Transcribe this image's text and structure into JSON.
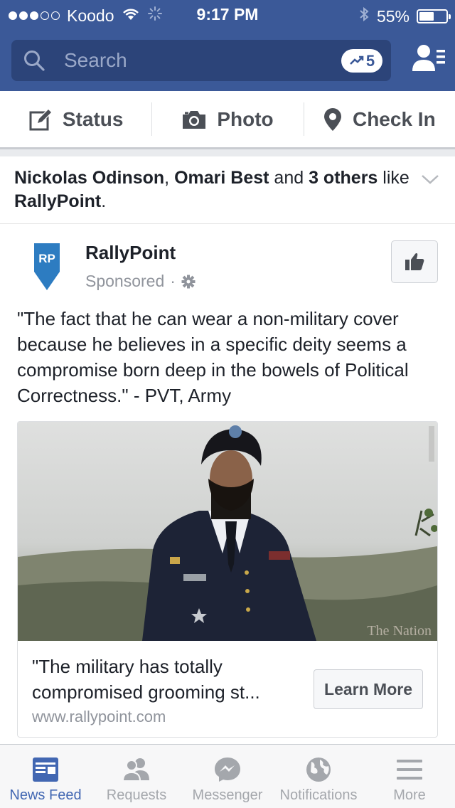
{
  "status_bar": {
    "carrier": "Koodo",
    "time": "9:17 PM",
    "battery_text": "55%",
    "battery_level": 0.55,
    "signal_bars_filled": 3,
    "signal_bars_total": 5
  },
  "search": {
    "placeholder": "Search",
    "trending_count": "5"
  },
  "composer": {
    "status_label": "Status",
    "photo_label": "Photo",
    "checkin_label": "Check In"
  },
  "story": {
    "social_name1": "Nickolas Odinson",
    "social_sep": ", ",
    "social_name2": "Omari Best",
    "social_and": " and ",
    "social_others": "3 others",
    "social_like": " like ",
    "social_page": "RallyPoint",
    "social_end": ".",
    "logo_text": "RP",
    "page_name": "RallyPoint",
    "sponsored": "Sponsored",
    "sponsored_dot": "·",
    "text": "\"The fact that he can wear a non-military cover because he believes in a specific deity seems a compromise born deep in the bowels of Political Correctness.\" - PVT, Army",
    "photo_watermark": "The Nation",
    "link_title": "\"The military has totally compromised grooming st...",
    "link_url": "www.rallypoint.com",
    "learn_more": "Learn More"
  },
  "tabs": [
    {
      "label": "News Feed",
      "icon": "news-feed-icon",
      "active": true
    },
    {
      "label": "Requests",
      "icon": "requests-icon",
      "active": false
    },
    {
      "label": "Messenger",
      "icon": "messenger-icon",
      "active": false
    },
    {
      "label": "Notifications",
      "icon": "globe-icon",
      "active": false
    },
    {
      "label": "More",
      "icon": "menu-icon",
      "active": false
    }
  ],
  "colors": {
    "brand": "#3b5998",
    "active_tab": "#4267b2",
    "inactive_tab": "#a4a7ac",
    "rallypoint_blue": "#2d7cc1"
  }
}
